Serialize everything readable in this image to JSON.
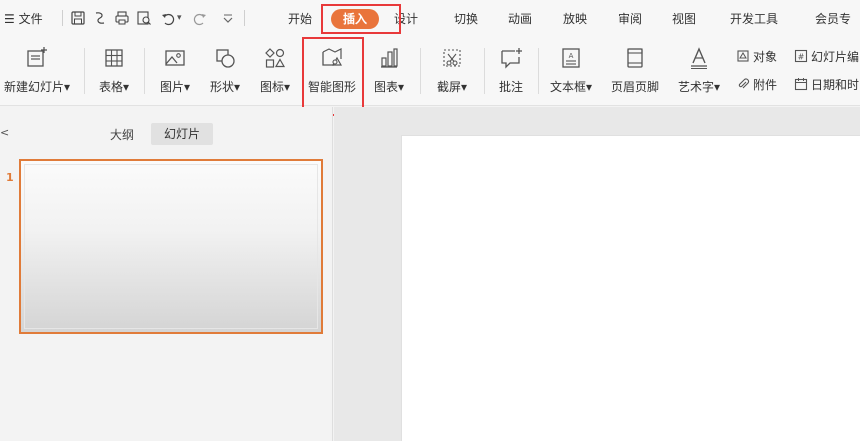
{
  "menubar": {
    "file": "☰ 文件",
    "tabs": {
      "start": "开始",
      "insert": "插入",
      "design": "设计",
      "transition": "切换",
      "animation": "动画",
      "slideshow": "放映",
      "review": "审阅",
      "view": "视图",
      "developer": "开发工具",
      "member": "会员专"
    }
  },
  "ribbon": {
    "new_slide": "新建幻灯片",
    "table": "表格",
    "picture": "图片",
    "shape": "形状",
    "icon": "图标",
    "smart_art": "智能图形",
    "chart": "图表",
    "screenshot": "截屏",
    "comment": "批注",
    "textbox": "文本框",
    "header_footer": "页眉页脚",
    "wordart": "艺术字",
    "object": "对象",
    "attachment": "附件",
    "slide_number": "幻灯片编",
    "datetime": "日期和时",
    "dropdown_arrow": "▾"
  },
  "leftpane": {
    "close": "<",
    "tab_outline": "大纲",
    "tab_slides": "幻灯片",
    "slides": [
      {
        "number": "1"
      }
    ]
  },
  "colors": {
    "accent_orange": "#e9743b",
    "highlight_red": "#e8393a"
  }
}
